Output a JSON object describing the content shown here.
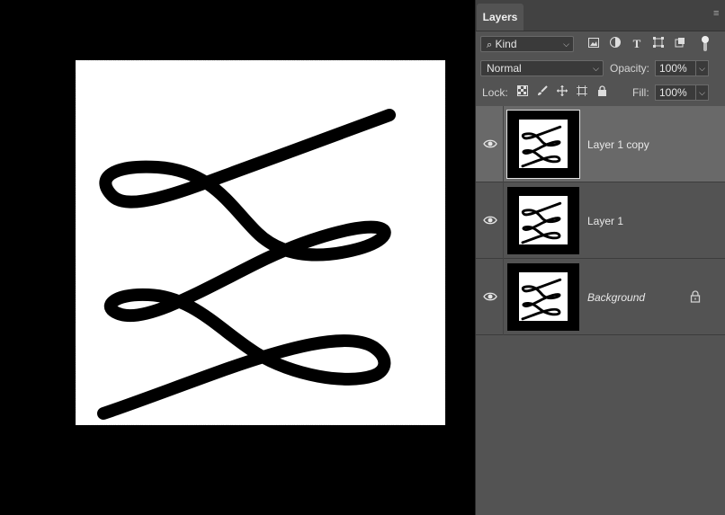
{
  "panel": {
    "tab_label": "Layers",
    "filter": {
      "kind_label": "Kind",
      "icons": [
        "search-icon",
        "image-filter-icon",
        "adjustment-filter-icon",
        "type-filter-icon",
        "shape-filter-icon",
        "smart-object-filter-icon",
        "filter-toggle-icon"
      ]
    },
    "blend_mode": "Normal",
    "opacity_label": "Opacity:",
    "opacity_value": "100%",
    "lock_label": "Lock:",
    "lock_icons": [
      "lock-transparent-icon",
      "lock-paint-icon",
      "lock-position-icon",
      "lock-artboard-icon",
      "lock-all-icon"
    ],
    "fill_label": "Fill:",
    "fill_value": "100%",
    "layers": [
      {
        "name": "Layer 1 copy",
        "visible": true,
        "selected": true,
        "locked": false
      },
      {
        "name": "Layer 1",
        "visible": true,
        "selected": false,
        "locked": false
      },
      {
        "name": "Background",
        "visible": true,
        "selected": false,
        "locked": true
      }
    ]
  },
  "colors": {
    "panel_bg": "#535353",
    "selected_layer_bg": "#696969",
    "canvas_bg": "#000000"
  }
}
